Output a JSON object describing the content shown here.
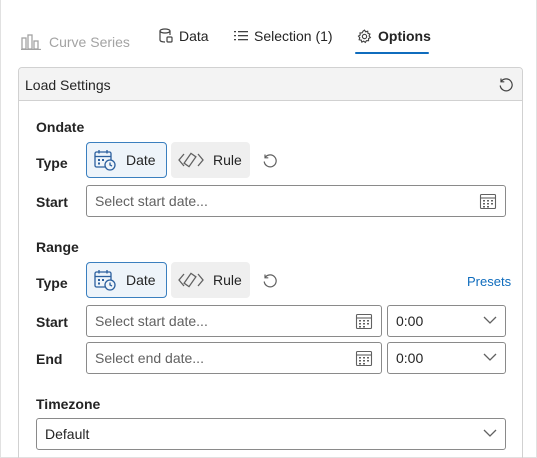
{
  "tabs": [
    {
      "label": "Curve Series",
      "icon": "bar-chart-icon",
      "state": "disabled"
    },
    {
      "label": "Data",
      "icon": "database-icon",
      "state": "normal"
    },
    {
      "label": "Selection (1)",
      "icon": "list-icon",
      "state": "normal"
    },
    {
      "label": "Options",
      "icon": "gear-icon",
      "state": "selected"
    }
  ],
  "panel": {
    "title": "Load Settings",
    "ondate": {
      "title": "Ondate",
      "type_label": "Type",
      "date_label": "Date",
      "rule_label": "Rule",
      "start_label": "Start",
      "start_placeholder": "Select start date..."
    },
    "range": {
      "title": "Range",
      "type_label": "Type",
      "date_label": "Date",
      "rule_label": "Rule",
      "presets_label": "Presets",
      "start_label": "Start",
      "start_placeholder": "Select start date...",
      "start_time": "0:00",
      "end_label": "End",
      "end_placeholder": "Select end date...",
      "end_time": "0:00"
    },
    "timezone": {
      "title": "Timezone",
      "value": "Default"
    }
  },
  "colors": {
    "accent": "#0f6cbd",
    "active_toggle_bg": "#eef4fa",
    "active_toggle_border": "#3a7fbf"
  }
}
